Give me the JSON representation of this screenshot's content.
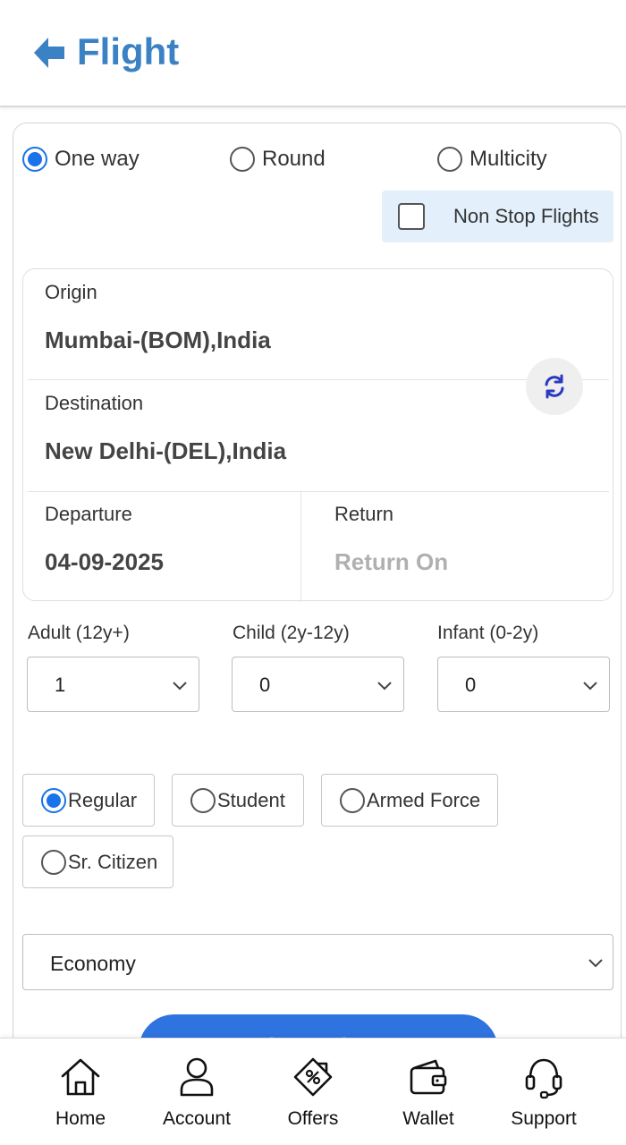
{
  "header": {
    "title": "Flight"
  },
  "trip_types": [
    {
      "label": "One way",
      "checked": true
    },
    {
      "label": "Round",
      "checked": false
    },
    {
      "label": "Multicity",
      "checked": false
    }
  ],
  "non_stop": {
    "label": "Non Stop Flights",
    "checked": false
  },
  "route": {
    "origin_label": "Origin",
    "origin_value": "Mumbai-(BOM),India",
    "destination_label": "Destination",
    "destination_value": "New Delhi-(DEL),India",
    "departure_label": "Departure",
    "departure_value": "04-09-2025",
    "return_label": "Return",
    "return_placeholder": "Return On"
  },
  "passengers": [
    {
      "label": "Adult (12y+)",
      "value": "1"
    },
    {
      "label": "Child (2y-12y)",
      "value": "0"
    },
    {
      "label": "Infant (0-2y)",
      "value": "0"
    }
  ],
  "fare_types": [
    {
      "label": "Regular",
      "checked": true
    },
    {
      "label": "Student",
      "checked": false
    },
    {
      "label": "Armed Force",
      "checked": false
    },
    {
      "label": "Sr. Citizen",
      "checked": false
    }
  ],
  "cabin_class": {
    "value": "Economy"
  },
  "search_button": {
    "label": "SEARCH"
  },
  "bottom_nav": [
    {
      "label": "Home",
      "icon": "home-icon"
    },
    {
      "label": "Account",
      "icon": "account-icon"
    },
    {
      "label": "Offers",
      "icon": "offers-icon"
    },
    {
      "label": "Wallet",
      "icon": "wallet-icon"
    },
    {
      "label": "Support",
      "icon": "support-icon"
    }
  ],
  "colors": {
    "primary": "#1a73e8",
    "title": "#3b82c4",
    "nonstop_bg": "#e3f0fc",
    "search": "#2f73e0"
  }
}
